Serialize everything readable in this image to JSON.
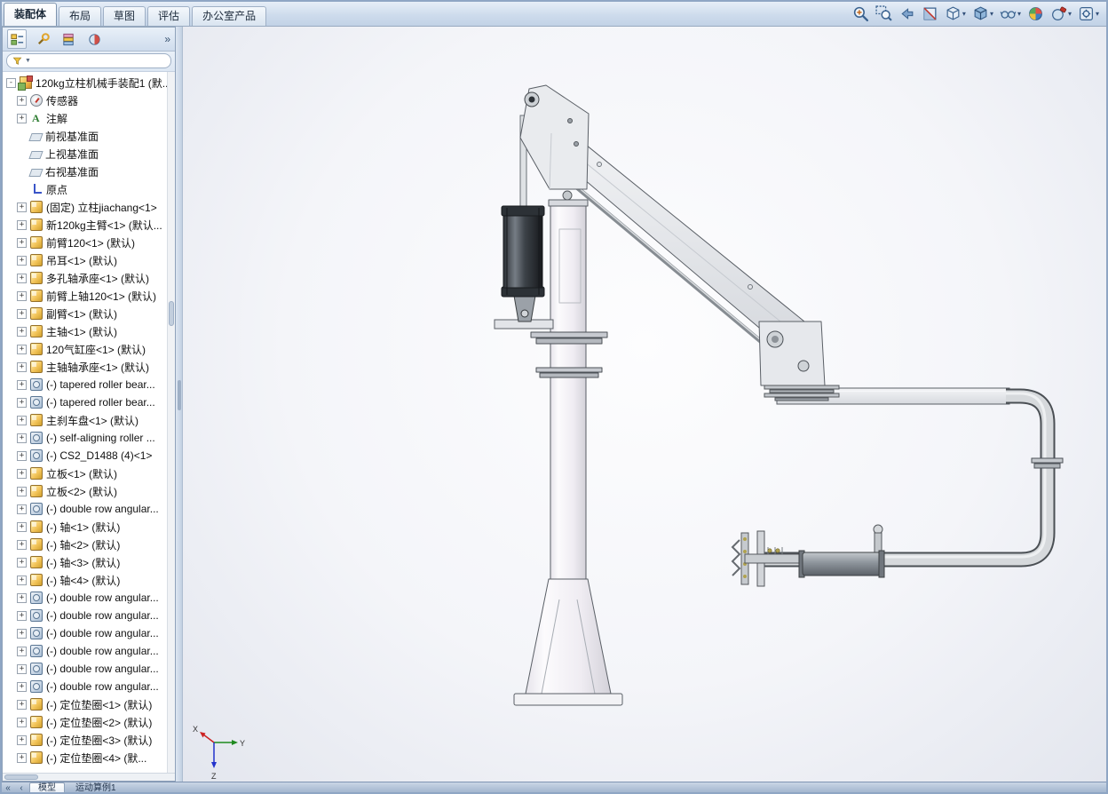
{
  "colors": {
    "chrome": "#cddbec",
    "viewport_bg": "#f4f5f9",
    "accent": "#3a628f"
  },
  "command_bar": {
    "tabs": [
      {
        "label": "装配体",
        "active": true
      },
      {
        "label": "布局",
        "active": false
      },
      {
        "label": "草图",
        "active": false
      },
      {
        "label": "评估",
        "active": false
      },
      {
        "label": "办公室产品",
        "active": false
      }
    ]
  },
  "view_toolbar": {
    "icons": [
      {
        "name": "zoom-in-icon",
        "caret": false
      },
      {
        "name": "zoom-area-icon",
        "caret": false
      },
      {
        "name": "previous-view-icon",
        "caret": false
      },
      {
        "name": "section-view-icon",
        "caret": false
      },
      {
        "name": "view-orientation-icon",
        "caret": true
      },
      {
        "name": "display-style-icon",
        "caret": true
      },
      {
        "name": "hide-show-items-icon",
        "caret": true
      },
      {
        "name": "edit-appearance-icon",
        "caret": false
      },
      {
        "name": "apply-scene-icon",
        "caret": true
      },
      {
        "name": "view-settings-icon",
        "caret": true
      }
    ]
  },
  "feature_panel": {
    "tab_icons": [
      {
        "name": "featuremanager-tab-icon"
      },
      {
        "name": "propertymanager-tab-icon"
      },
      {
        "name": "configurationmanager-tab-icon"
      },
      {
        "name": "displaymanager-tab-icon"
      }
    ],
    "overflow_chevron": "»",
    "filter_caret": "▼",
    "root": {
      "label": "120kg立柱机械手装配1 (默..."
    },
    "items": [
      {
        "icon": "sensors",
        "label": "传感器",
        "expand": true
      },
      {
        "icon": "annotations",
        "label": "注解",
        "expand": true
      },
      {
        "icon": "plane",
        "label": "前视基准面",
        "expand": false
      },
      {
        "icon": "plane",
        "label": "上视基准面",
        "expand": false
      },
      {
        "icon": "plane",
        "label": "右视基准面",
        "expand": false
      },
      {
        "icon": "origin",
        "label": "原点",
        "expand": false
      },
      {
        "icon": "part",
        "label": "(固定) 立柱jiachang<1>",
        "expand": true
      },
      {
        "icon": "part",
        "label": "新120kg主臂<1> (默认...",
        "expand": true
      },
      {
        "icon": "part",
        "label": "前臂120<1> (默认)",
        "expand": true
      },
      {
        "icon": "part",
        "label": "吊耳<1> (默认)",
        "expand": true
      },
      {
        "icon": "part",
        "label": "多孔轴承座<1> (默认)",
        "expand": true
      },
      {
        "icon": "part",
        "label": "前臂上轴120<1> (默认)",
        "expand": true
      },
      {
        "icon": "part",
        "label": "副臂<1> (默认)",
        "expand": true
      },
      {
        "icon": "part",
        "label": "主轴<1> (默认)",
        "expand": true
      },
      {
        "icon": "part",
        "label": "120气缸座<1> (默认)",
        "expand": true
      },
      {
        "icon": "part",
        "label": "主轴轴承座<1> (默认)",
        "expand": true
      },
      {
        "icon": "bearing",
        "label": "(-) tapered roller bear...",
        "expand": true
      },
      {
        "icon": "bearing",
        "label": "(-) tapered roller bear...",
        "expand": true
      },
      {
        "icon": "part",
        "label": "主刹车盘<1> (默认)",
        "expand": true
      },
      {
        "icon": "bearing",
        "label": "(-) self-aligning roller ...",
        "expand": true
      },
      {
        "icon": "bearing",
        "label": "(-) CS2_D1488 (4)<1>",
        "expand": true
      },
      {
        "icon": "part",
        "label": "立板<1> (默认)",
        "expand": true
      },
      {
        "icon": "part",
        "label": "立板<2> (默认)",
        "expand": true
      },
      {
        "icon": "bearing",
        "label": "(-) double row angular...",
        "expand": true
      },
      {
        "icon": "part",
        "label": "(-) 轴<1> (默认)",
        "expand": true
      },
      {
        "icon": "part",
        "label": "(-) 轴<2> (默认)",
        "expand": true
      },
      {
        "icon": "part",
        "label": "(-) 轴<3> (默认)",
        "expand": true
      },
      {
        "icon": "part",
        "label": "(-) 轴<4> (默认)",
        "expand": true
      },
      {
        "icon": "bearing",
        "label": "(-) double row angular...",
        "expand": true
      },
      {
        "icon": "bearing",
        "label": "(-) double row angular...",
        "expand": true
      },
      {
        "icon": "bearing",
        "label": "(-) double row angular...",
        "expand": true
      },
      {
        "icon": "bearing",
        "label": "(-) double row angular...",
        "expand": true
      },
      {
        "icon": "bearing",
        "label": "(-) double row angular...",
        "expand": true
      },
      {
        "icon": "bearing",
        "label": "(-) double row angular...",
        "expand": true
      },
      {
        "icon": "part",
        "label": "(-) 定位垫圈<1> (默认)",
        "expand": true
      },
      {
        "icon": "part",
        "label": "(-) 定位垫圈<2> (默认)",
        "expand": true
      },
      {
        "icon": "part",
        "label": "(-) 定位垫圈<3> (默认)",
        "expand": true
      },
      {
        "icon": "part",
        "label": "(-) 定位垫圈<4> (默...",
        "expand": true
      }
    ]
  },
  "viewport": {
    "triad": {
      "x": "X",
      "y": "Y",
      "z": "Z"
    }
  },
  "status_bar": {
    "nav": [
      "«",
      "‹"
    ],
    "tabs": [
      {
        "label": "模型",
        "active": true
      },
      {
        "label": "运动算例1",
        "active": false
      }
    ]
  }
}
